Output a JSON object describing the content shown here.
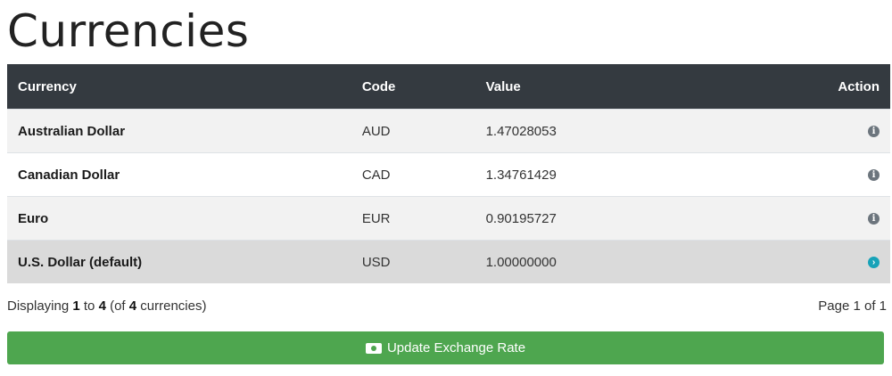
{
  "page": {
    "title": "Currencies"
  },
  "table": {
    "headers": {
      "currency": "Currency",
      "code": "Code",
      "value": "Value",
      "action": "Action"
    },
    "rows": [
      {
        "currency": "Australian Dollar",
        "code": "AUD",
        "value": "1.47028053",
        "action_icon": "info-icon"
      },
      {
        "currency": "Canadian Dollar",
        "code": "CAD",
        "value": "1.34761429",
        "action_icon": "info-icon"
      },
      {
        "currency": "Euro",
        "code": "EUR",
        "value": "0.90195727",
        "action_icon": "info-icon"
      },
      {
        "currency": "U.S. Dollar (default)",
        "code": "USD",
        "value": "1.00000000",
        "action_icon": "arrow-right-circle-icon",
        "selected": true
      }
    ]
  },
  "footer": {
    "prefix": "Displaying ",
    "from": "1",
    "to_word": " to ",
    "to": "4",
    "of_open": " (of ",
    "total": "4",
    "suffix": " currencies)",
    "page_text": "Page 1 of 1"
  },
  "button": {
    "update_label": "Update Exchange Rate"
  },
  "colors": {
    "header_bg": "#343a40",
    "button_bg": "#4ea64f",
    "info_icon": "#6c757d",
    "arrow_icon": "#17a2b8",
    "selected_row": "#dadada"
  }
}
